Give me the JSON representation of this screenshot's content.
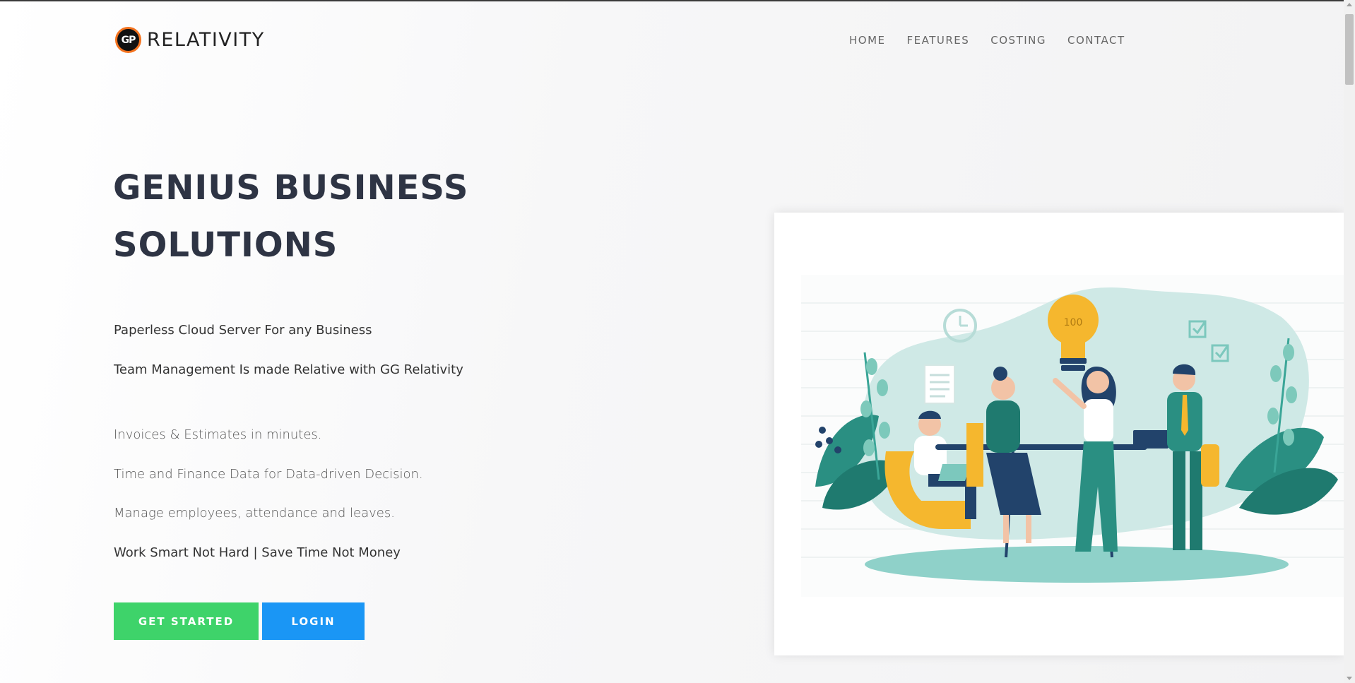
{
  "brand": {
    "logo_initials": "GP",
    "name": "RELATIVITY"
  },
  "nav": {
    "items": [
      "HOME",
      "FEATURES",
      "COSTING",
      "CONTACT"
    ]
  },
  "hero": {
    "title": "GENIUS BUSINESS SOLUTIONS",
    "lead1": "Paperless Cloud Server For any Business",
    "lead2": "Team Management Is made Relative with GG Relativity",
    "features": [
      "Invoices & Estimates in minutes.",
      "Time and Finance Data for Data-driven Decision.",
      "Manage employees, attendance and leaves."
    ],
    "tagline": "Work Smart Not Hard | Save Time Not Money",
    "buttons": {
      "get_started": "GET STARTED",
      "login": "LOGIN"
    }
  },
  "illustration": {
    "bulb_text": "100"
  },
  "colors": {
    "accent_green": "#3ed36a",
    "accent_blue": "#1a96f5",
    "heading": "#2e3444",
    "illustration_teal": "#2a8f82",
    "illustration_yellow": "#f5b72e"
  }
}
